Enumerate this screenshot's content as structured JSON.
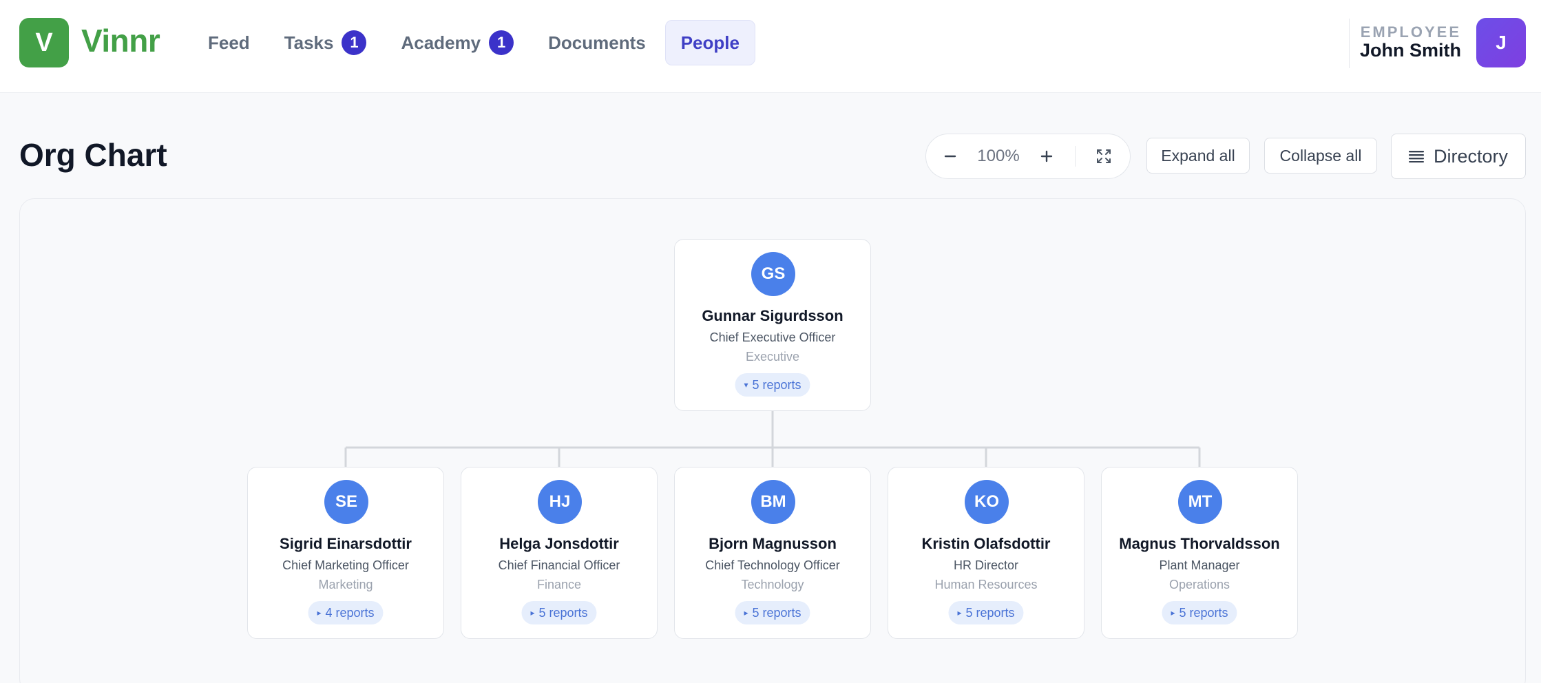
{
  "brand": {
    "logo_letter": "V",
    "name": "Vinnr"
  },
  "nav": [
    {
      "label": "Feed",
      "badge": ""
    },
    {
      "label": "Tasks",
      "badge": "1"
    },
    {
      "label": "Academy",
      "badge": "1"
    },
    {
      "label": "Documents",
      "badge": ""
    },
    {
      "label": "People",
      "badge": "",
      "active": true
    }
  ],
  "user": {
    "role": "EMPLOYEE",
    "name": "John Smith",
    "avatar_letter": "J"
  },
  "page": {
    "title": "Org Chart"
  },
  "toolbar": {
    "zoom_out_icon": "minus-icon",
    "zoom_value": "100%",
    "zoom_in_icon": "plus-icon",
    "fit_icon": "fullscreen-icon",
    "expand_label": "Expand all",
    "collapse_label": "Collapse all",
    "directory_label": "Directory",
    "directory_icon": "list-icon"
  },
  "colors": {
    "brand_green": "#43a047",
    "accent_indigo": "#3b32c9",
    "avatar_blue": "#4a80ea",
    "user_avatar": "#6d4ee8"
  },
  "org": {
    "root": {
      "initials": "GS",
      "name": "Gunnar Sigurdsson",
      "title": "Chief Executive Officer",
      "department": "Executive",
      "reports": "5 reports",
      "caret": "▾"
    },
    "children": [
      {
        "initials": "SE",
        "name": "Sigrid Einarsdottir",
        "title": "Chief Marketing Officer",
        "department": "Marketing",
        "reports": "4 reports",
        "caret": "▸"
      },
      {
        "initials": "HJ",
        "name": "Helga Jonsdottir",
        "title": "Chief Financial Officer",
        "department": "Finance",
        "reports": "5 reports",
        "caret": "▸"
      },
      {
        "initials": "BM",
        "name": "Bjorn Magnusson",
        "title": "Chief Technology Officer",
        "department": "Technology",
        "reports": "5 reports",
        "caret": "▸"
      },
      {
        "initials": "KO",
        "name": "Kristin Olafsdottir",
        "title": "HR Director",
        "department": "Human Resources",
        "reports": "5 reports",
        "caret": "▸"
      },
      {
        "initials": "MT",
        "name": "Magnus Thorvaldsson",
        "title": "Plant Manager",
        "department": "Operations",
        "reports": "5 reports",
        "caret": "▸"
      }
    ]
  }
}
